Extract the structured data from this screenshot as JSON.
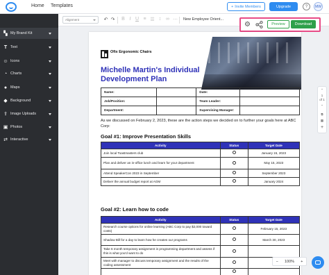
{
  "topbar": {
    "nav": [
      "Home",
      "Templates"
    ],
    "invite_label": "Invite Members",
    "upgrade_label": "Upgrade",
    "help_label": "?",
    "avatar_label": "MW"
  },
  "sidebar": {
    "items": [
      {
        "label": "My Brand Kit",
        "icon": "brand-kit-icon"
      },
      {
        "label": "Text",
        "icon": "text-icon"
      },
      {
        "label": "Icons",
        "icon": "icons-icon"
      },
      {
        "label": "Charts",
        "icon": "charts-icon"
      },
      {
        "label": "Maps",
        "icon": "maps-icon"
      },
      {
        "label": "Background",
        "icon": "background-icon"
      },
      {
        "label": "Image Uploads",
        "icon": "upload-icon"
      },
      {
        "label": "Photos",
        "icon": "photos-icon"
      },
      {
        "label": "Interactive",
        "icon": "interactive-icon"
      }
    ]
  },
  "toolbar": {
    "font_select": "Alignment",
    "doc_title": "New Employee Orient..."
  },
  "actions": {
    "preview_label": "Preview",
    "download_label": "Download"
  },
  "document": {
    "brand_name": "Ofix Ergonomic Chairs",
    "heading": "Michelle Martin's Individual Development Plan",
    "info": [
      [
        "Name:",
        "",
        "Date:",
        ""
      ],
      [
        "Job/Position:",
        "",
        "Team Leader:",
        ""
      ],
      [
        "Department:",
        "",
        "Supervising Manager:",
        ""
      ]
    ],
    "intro": "As we discussed on February 2, 2023, these are the action steps we decided on to further your goals here at ABC Corp:",
    "goal1": {
      "title": "Goal #1: Improve Presentation Skills",
      "headers": [
        "Activity",
        "Status",
        "Target Date"
      ],
      "rows": [
        [
          "Join local Toastmasters club",
          "",
          "January 15, 2023"
        ],
        [
          "Plan and deliver an in-office lunch and learn for your department",
          "",
          "May 15, 2023"
        ],
        [
          "Attend SpeakerCon 2023 in September",
          "",
          "September 2023"
        ],
        [
          "Deliver the annual budget report at AGM",
          "",
          "January 2024"
        ]
      ]
    },
    "goal2": {
      "title": "Goal #2: Learn how to code",
      "headers": [
        "Activity",
        "Status",
        "Target Date"
      ],
      "rows": [
        [
          "Research course options for online learning (ABC Corp to pay $2,000 toward costs)",
          "",
          "February 15, 2023"
        ],
        [
          "Shadow Bill for a day to learn how he creates our programs",
          "",
          "March 30, 2023"
        ],
        [
          "Take 6 month temporary assignment in programming department and assess if this is what you'd want to do",
          "",
          ""
        ],
        [
          "Meet with manager to discuss temporary assignment and the results of the coding assessment",
          "",
          ""
        ],
        [
          "",
          "",
          ""
        ]
      ]
    }
  },
  "rail": {
    "page_num": "1",
    "page_of": "of 1"
  },
  "zoom": {
    "minus": "−",
    "value": "100%",
    "plus": "+"
  }
}
